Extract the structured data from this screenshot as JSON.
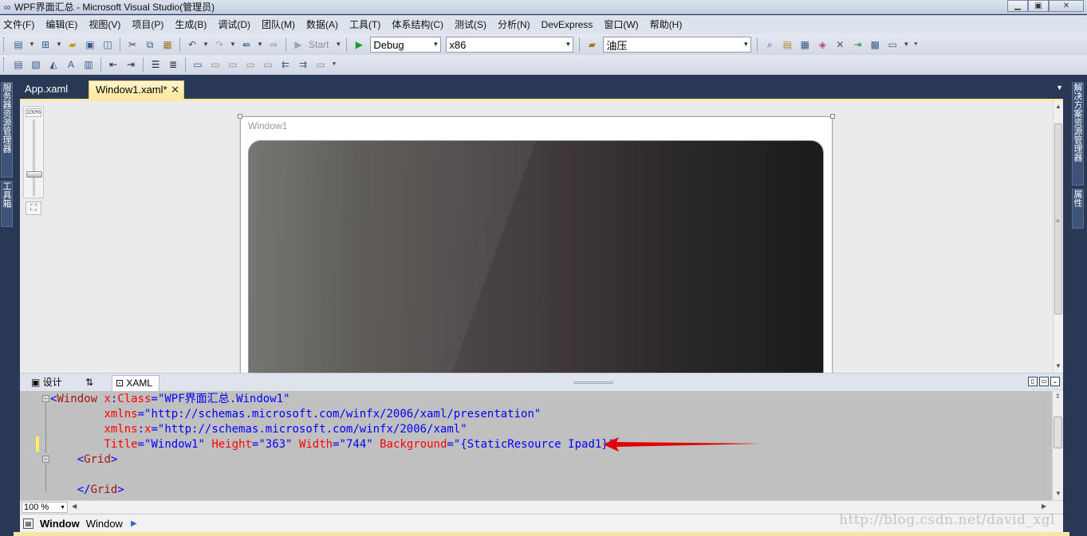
{
  "window": {
    "title": "WPF界面汇总 - Microsoft Visual Studio(管理员)",
    "minimize": "▁",
    "maximize": "▣",
    "close": "✕"
  },
  "menu": [
    "文件(F)",
    "编辑(E)",
    "视图(V)",
    "项目(P)",
    "生成(B)",
    "调试(D)",
    "团队(M)",
    "数据(A)",
    "工具(T)",
    "体系结构(C)",
    "测试(S)",
    "分析(N)",
    "DevExpress",
    "窗口(W)",
    "帮助(H)"
  ],
  "toolbar": {
    "start_label": "Start",
    "config": "Debug",
    "platform": "x86",
    "find": "油压"
  },
  "side_left": {
    "server_explorer": "服务器资源管理器",
    "toolbox": "工具箱"
  },
  "side_right": {
    "solution_explorer": "解决方案资源管理器",
    "properties": "属性"
  },
  "tabs": [
    {
      "label": "App.xaml"
    },
    {
      "label": "Window1.xaml*"
    }
  ],
  "designer": {
    "zoom_badge": "100%",
    "zoom_level": 0.72,
    "window_title": "Window1"
  },
  "bottom_tabs": {
    "design": "设计",
    "swap": "⇅",
    "xaml": "XAML"
  },
  "code": {
    "line1": {
      "lt": "<",
      "tag": "Window",
      "attr": "x",
      "colon": ":",
      "attr2": "Class",
      "eq": "=",
      "value": "\"WPF界面汇总.Window1\""
    },
    "line2": {
      "attr": "xmlns",
      "eq": "=",
      "value": "\"http://schemas.microsoft.com/winfx/2006/xaml/presentation\""
    },
    "line3": {
      "attr": "xmlns",
      "colon": ":",
      "attr2": "x",
      "eq": "=",
      "value": "\"http://schemas.microsoft.com/winfx/2006/xaml\""
    },
    "line4": {
      "attr_title": "Title",
      "eq": "=",
      "val_title": "\"Window1\"",
      "attr_height": "Height",
      "val_height": "\"363\"",
      "attr_width": "Width",
      "val_width": "\"744\"",
      "attr_bg": "Background",
      "val_bg_q": "\"",
      "val_bg": "{StaticResource Ipad1}",
      "end": "\">"
    },
    "line5": {
      "lt": "<",
      "tag": "Grid",
      "gt": ">"
    },
    "line7": {
      "lt": "</",
      "tag": "Grid",
      "gt": ">"
    }
  },
  "status": {
    "zoom": "100 %",
    "breadcrumb_bold": "Window",
    "breadcrumb": "Window"
  },
  "watermark": "http://blog.csdn.net/david_xgl",
  "colors": {
    "xaml_tag": "#a31515",
    "xaml_attr": "#ff0000",
    "xaml_value": "#0000ff",
    "annotation_arrow": "#e00000",
    "active_tab": "#ffe79a"
  }
}
